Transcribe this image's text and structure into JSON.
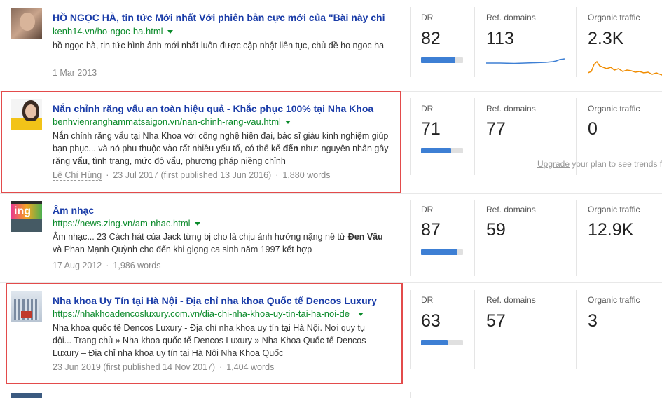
{
  "rows": [
    {
      "title": "HỒ NGỌC HÀ, tin tức Mới nhất Với phiên bản cực mới của \"Bài này chi",
      "url": "kenh14.vn/ho-ngoc-ha.html",
      "snippet": "hồ ngọc hà, tin tức hình ảnh mới nhất luôn được cập nhật liên tục, chủ đề ho ngoc ha",
      "date": "1 Mar 2013",
      "dr_label": "DR",
      "dr_value": "82",
      "dr_bar": 0.82,
      "ref_label": "Ref. domains",
      "ref_value": "113",
      "traffic_label": "Organic traffic",
      "traffic_value": "2.3K",
      "highlighted": false
    },
    {
      "title": "Nắn chỉnh răng vẩu an toàn hiệu quả - Khắc phục 100% tại Nha Khoa",
      "url": "benhvienranghammatsaigon.vn/nan-chinh-rang-vau.html",
      "snippet_html": "Nắn chỉnh răng vẩu tại Nha Khoa với công nghệ hiện đại, bác sĩ giàu kinh nghiệm giúp bạn phục... và nó phu thuộc vào rất nhiều yếu tố, có thể kể <b>đến</b> như: nguyên nhân gây răng <b>vẩu</b>, tình trạng, mức độ vẩu, phương pháp niềng chỉnh",
      "author": "Lê Chí Hùng",
      "date": "23 Jul 2017 (first published 13 Jun 2016)",
      "words": "1,880 words",
      "dr_label": "DR",
      "dr_value": "71",
      "dr_bar": 0.71,
      "ref_label": "Ref. domains",
      "ref_value": "77",
      "traffic_label": "Organic traffic",
      "traffic_value": "0",
      "upgrade_link": "Upgrade",
      "upgrade_rest": " your plan to see trends f",
      "highlighted": true
    },
    {
      "title": "Âm nhạc",
      "url": "https://news.zing.vn/am-nhac.html",
      "snippet_html": "Âm nhạc... 23 Cách hát của Jack từng bị cho là chịu ảnh hưởng nặng nề từ <b>Đen Vâu</b> và Phan Mạnh Quỳnh cho đến khi giọng ca sinh năm 1997 kết hợp",
      "date": "17 Aug 2012",
      "words": "1,986 words",
      "dr_label": "DR",
      "dr_value": "87",
      "dr_bar": 0.87,
      "ref_label": "Ref. domains",
      "ref_value": "59",
      "traffic_label": "Organic traffic",
      "traffic_value": "12.9K",
      "highlighted": false
    },
    {
      "title": "Nha khoa Uy Tín tại Hà Nội - Địa chỉ nha khoa Quốc tế Dencos Luxury",
      "url": "https://nhakhoadencosluxury.com.vn/dia-chi-nha-khoa-uy-tin-tai-ha-noi-de",
      "snippet": "Nha khoa quốc tế Dencos Luxury - Địa chỉ nha khoa uy tín tại Hà Nội. Nơi quy tụ đội... Trang chủ » Nha khoa quốc tế Dencos Luxury » Nha Khoa Quốc tế Dencos Luxury – Địa chỉ nha khoa uy tín tại Hà Nội Nha Khoa Quốc",
      "date": "23 Jun 2019 (first published 14 Nov 2017)",
      "words": "1,404 words",
      "dr_label": "DR",
      "dr_value": "63",
      "dr_bar": 0.63,
      "ref_label": "Ref. domains",
      "ref_value": "57",
      "traffic_label": "Organic traffic",
      "traffic_value": "3",
      "highlighted": true
    }
  ],
  "colors": {
    "title": "#1a3ca8",
    "url": "#0a8a2a",
    "bar": "#3d7fd4",
    "highlight": "#e34b4b",
    "sparkline_ref": "#3d7fd4",
    "sparkline_traffic": "#f08c00"
  }
}
